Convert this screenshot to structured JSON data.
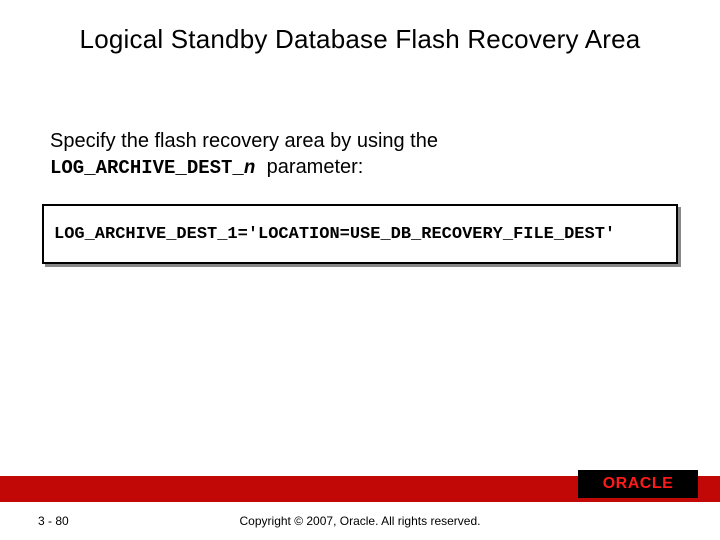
{
  "title": "Logical Standby Database Flash Recovery Area",
  "body": {
    "lead": "Specify the flash recovery area by using the",
    "param_prefix": "LOG_ARCHIVE_DEST_",
    "param_n": "n",
    "trail": " parameter:"
  },
  "code": "LOG_ARCHIVE_DEST_1='LOCATION=USE_DB_RECOVERY_FILE_DEST'",
  "footer": {
    "page": "3 - 80",
    "copyright": "Copyright © 2007, Oracle. All rights reserved.",
    "logo": "ORACLE"
  },
  "colors": {
    "footer_bar": "#c20707",
    "logo_bg": "#000000",
    "logo_text": "#ff1a1a"
  }
}
